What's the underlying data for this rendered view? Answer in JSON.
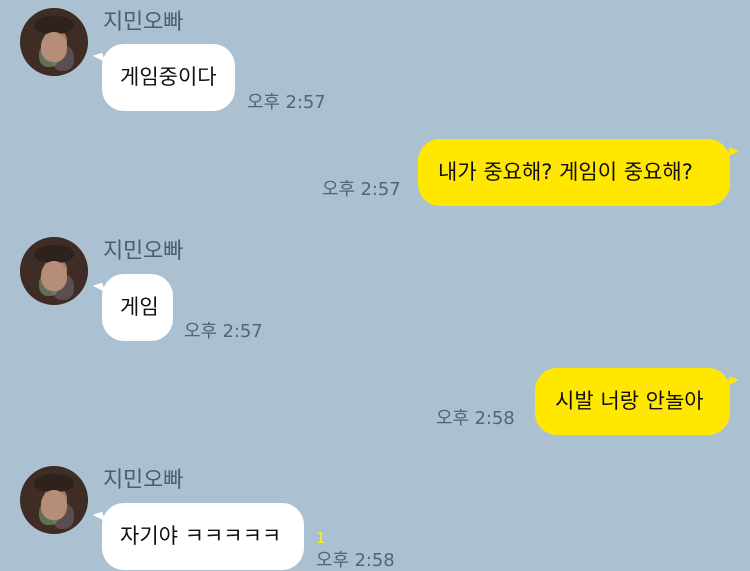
{
  "app": {
    "background": "#abc1d1",
    "incoming_bubble_color": "#ffffff",
    "outgoing_bubble_color": "#ffe700",
    "unread_color": "#fff200"
  },
  "messages": [
    {
      "sender": "지민오빠",
      "text": "게임중이다",
      "time": "오후 2:57",
      "direction": "incoming"
    },
    {
      "text": "내가 중요해? 게임이 중요해?",
      "time": "오후 2:57",
      "direction": "outgoing"
    },
    {
      "sender": "지민오빠",
      "text": "게임",
      "time": "오후 2:57",
      "direction": "incoming"
    },
    {
      "text": "시발 너랑 안놀아",
      "time": "오후 2:58",
      "direction": "outgoing"
    },
    {
      "sender": "지민오빠",
      "text": "자기야 ㅋㅋㅋㅋㅋ",
      "time": "오후 2:58",
      "unread": "1",
      "direction": "incoming"
    }
  ]
}
